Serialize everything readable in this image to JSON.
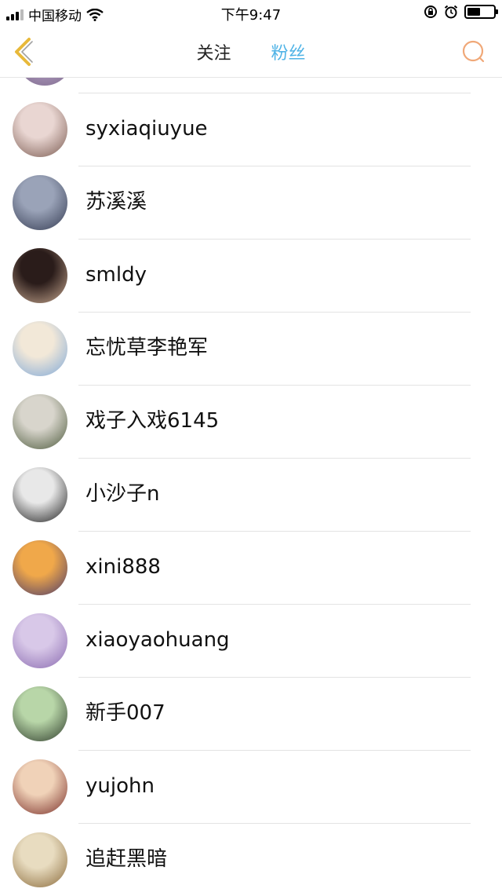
{
  "status_bar": {
    "carrier": "中国移动",
    "time": "下午9:47"
  },
  "nav": {
    "tabs": [
      {
        "label": "关注",
        "active": false
      },
      {
        "label": "粉丝",
        "active": true
      }
    ],
    "active_color": "#4fb3e6",
    "accent_color": "#e8b93a",
    "search_icon_color": "#f0a878"
  },
  "fans": [
    {
      "name": "syxiaqiuyue",
      "avatar_colors": [
        "#e9d6d2",
        "#7a5a50"
      ]
    },
    {
      "name": "苏溪溪",
      "avatar_colors": [
        "#9aa3b8",
        "#343b52"
      ]
    },
    {
      "name": "smldy",
      "avatar_colors": [
        "#2a1c1a",
        "#c8a890"
      ]
    },
    {
      "name": "忘忧草李艳军",
      "avatar_colors": [
        "#f2e8d8",
        "#7fa8d8"
      ]
    },
    {
      "name": "戏子入戏6145",
      "avatar_colors": [
        "#d8d5cc",
        "#4d5a3c"
      ]
    },
    {
      "name": "小沙子n",
      "avatar_colors": [
        "#e8e8e8",
        "#1e1e1e"
      ]
    },
    {
      "name": "xini888",
      "avatar_colors": [
        "#f0a84a",
        "#4a3a6a"
      ]
    },
    {
      "name": "xiaoyaohuang",
      "avatar_colors": [
        "#d8c8e8",
        "#8a6ab0"
      ]
    },
    {
      "name": "新手007",
      "avatar_colors": [
        "#b8d6a8",
        "#2d3a2a"
      ]
    },
    {
      "name": "yujohn",
      "avatar_colors": [
        "#f0d2b8",
        "#7a2e28"
      ]
    },
    {
      "name": "追赶黑暗",
      "avatar_colors": [
        "#e8dcc0",
        "#8a6a3a"
      ]
    }
  ]
}
